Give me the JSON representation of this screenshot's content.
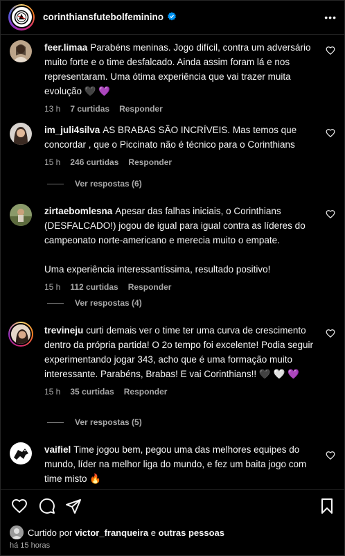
{
  "post": {
    "username": "corinthiansfutebolfeminino",
    "verified": true
  },
  "comments": [
    {
      "user": "feer.limaa",
      "text": "Parabéns meninas. Jogo difícil, contra um adversário muito forte e o time desfalcado. Ainda assim foram lá e nos representaram. Uma ótima experiência que vai trazer muita evolução 🖤 💜",
      "time": "13 h",
      "likes": "7 curtidas",
      "reply": "Responder"
    },
    {
      "user": "im_juli4silva",
      "text": "AS BRABAS SÃO INCRÍVEIS. Mas temos que concordar , que o Piccinato não é técnico para o Corinthians",
      "time": "15 h",
      "likes": "246 curtidas",
      "reply": "Responder",
      "replies": "Ver respostas (6)"
    },
    {
      "user": "zirtaebomlesna",
      "text": "Apesar das falhas iniciais, o Corinthians (DESFALCADO!) jogou de igual para igual contra as líderes do campeonato norte-americano e merecia muito o empate.",
      "text2": "Uma experiência interessantíssima, resultado positivo!",
      "time": "15 h",
      "likes": "112 curtidas",
      "reply": "Responder",
      "replies": "Ver respostas (4)"
    },
    {
      "user": "trevineju",
      "text": "curti demais ver o time ter uma curva de crescimento dentro da própria partida! O 2o tempo foi excelente! Podia seguir experimentando jogar 343, acho que é uma formação muito interessante. Parabéns, Brabas! E vai Corinthians!! 🖤 🤍 💜",
      "time": "15 h",
      "likes": "35 curtidas",
      "reply": "Responder",
      "replies": "Ver respostas (5)"
    },
    {
      "user": "vaifiel",
      "text": "Time jogou bem, pegou uma das melhores equipes do mundo, líder na melhor liga do mundo, e fez um baita jogo com time misto 🔥"
    }
  ],
  "footer": {
    "liked_prefix": "Curtido por",
    "liked_user": "victor_franqueira",
    "liked_mid": "e",
    "liked_rest": "outras pessoas",
    "posted": "há 15 horas"
  },
  "icons": {
    "like": "heart-icon",
    "comment": "comment-icon",
    "share": "send-icon",
    "save": "bookmark-icon",
    "more": "more-dots-icon"
  },
  "colors": {
    "background": "#000000",
    "text": "#f5f5f5",
    "muted": "#a8a8a8",
    "verified": "#0095f6"
  }
}
